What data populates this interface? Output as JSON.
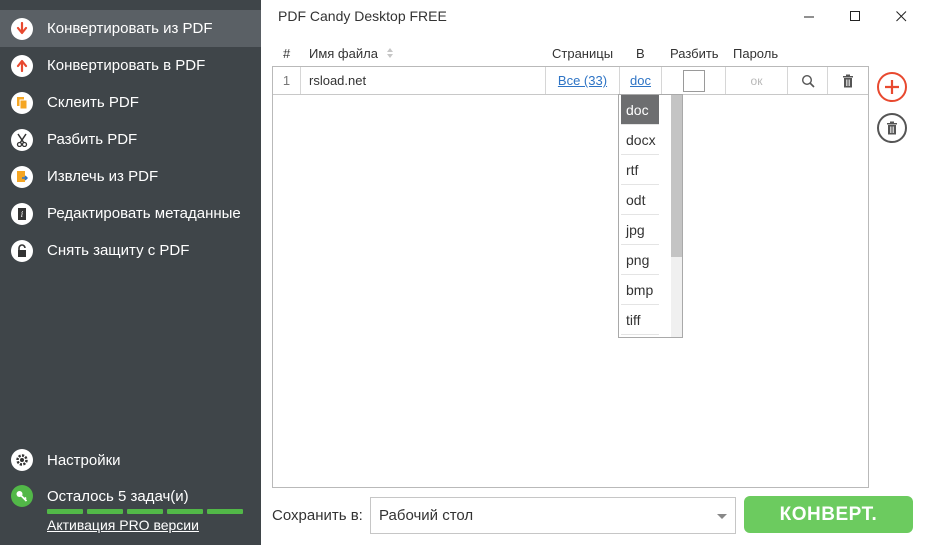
{
  "sidebar": {
    "items": [
      {
        "label": "Конвертировать из PDF",
        "icon": "convert-from-pdf-icon",
        "active": true
      },
      {
        "label": "Конвертировать в PDF",
        "icon": "convert-to-pdf-icon",
        "active": false
      },
      {
        "label": "Склеить PDF",
        "icon": "merge-pdf-icon",
        "active": false
      },
      {
        "label": "Разбить PDF",
        "icon": "split-pdf-icon",
        "active": false
      },
      {
        "label": "Извлечь из PDF",
        "icon": "extract-pdf-icon",
        "active": false
      },
      {
        "label": "Редактировать метаданные",
        "icon": "edit-metadata-icon",
        "active": false
      },
      {
        "label": "Снять защиту с PDF",
        "icon": "unlock-pdf-icon",
        "active": false
      }
    ],
    "settings_label": "Настройки",
    "tasks_left_label": "Осталось 5 задач(и)",
    "tasks_remaining": 5,
    "pro_link_label": "Активация PRO версии"
  },
  "window": {
    "title": "PDF Candy Desktop FREE"
  },
  "table": {
    "headers": {
      "num": "#",
      "filename": "Имя файла",
      "pages": "Страницы",
      "format": "В",
      "split": "Разбить",
      "password": "Пароль"
    },
    "rows": [
      {
        "num": "1",
        "filename": "rsload.net",
        "pages": "Все (33)",
        "format": "doc",
        "password": "ок"
      }
    ]
  },
  "format_dropdown": {
    "options": [
      "doc",
      "docx",
      "rtf",
      "odt",
      "jpg",
      "png",
      "bmp",
      "tiff"
    ],
    "selected": "doc"
  },
  "footer": {
    "save_label": "Сохранить в:",
    "save_value": "Рабочий стол",
    "convert_label": "КОНВЕРТ."
  },
  "colors": {
    "sidebar_bg": "#3f4549",
    "sidebar_active": "#5a6065",
    "accent_red": "#e8492f",
    "accent_green": "#6ccb5f",
    "link_blue": "#2e74c5"
  }
}
